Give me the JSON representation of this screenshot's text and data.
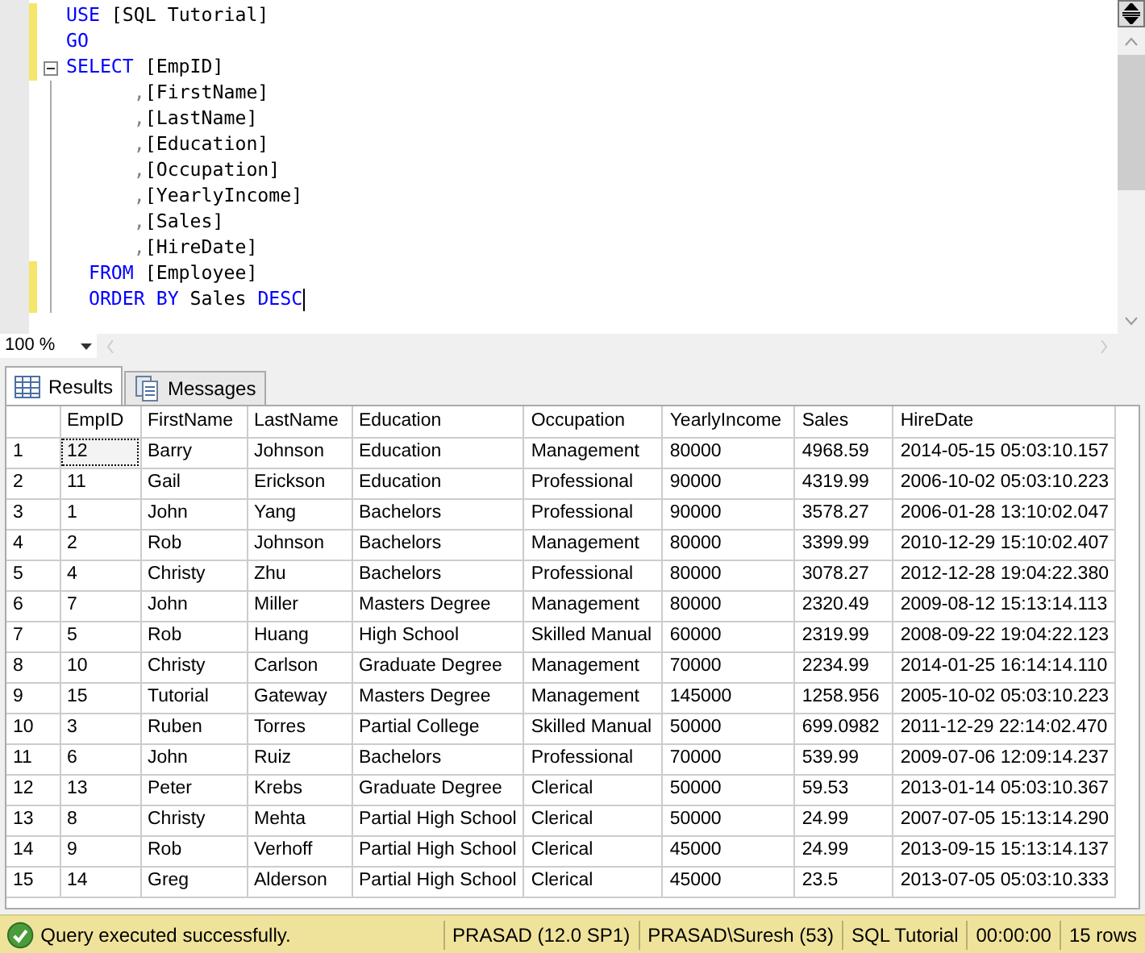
{
  "editor": {
    "lines": [
      {
        "changed": true,
        "tokens": [
          {
            "kind": "keyword",
            "text": "USE"
          },
          {
            "kind": "text",
            "text": " [SQL Tutorial]"
          }
        ]
      },
      {
        "changed": true,
        "tokens": [
          {
            "kind": "keyword",
            "text": "GO"
          }
        ]
      },
      {
        "changed": true,
        "fold": true,
        "tokens": [
          {
            "kind": "keyword",
            "text": "SELECT"
          },
          {
            "kind": "text",
            "text": " [EmpID]"
          }
        ]
      },
      {
        "changed": false,
        "tokens": [
          {
            "kind": "punct",
            "text": "      ,"
          },
          {
            "kind": "text",
            "text": "[FirstName]"
          }
        ]
      },
      {
        "changed": false,
        "tokens": [
          {
            "kind": "punct",
            "text": "      ,"
          },
          {
            "kind": "text",
            "text": "[LastName]"
          }
        ]
      },
      {
        "changed": false,
        "tokens": [
          {
            "kind": "punct",
            "text": "      ,"
          },
          {
            "kind": "text",
            "text": "[Education]"
          }
        ]
      },
      {
        "changed": false,
        "tokens": [
          {
            "kind": "punct",
            "text": "      ,"
          },
          {
            "kind": "text",
            "text": "[Occupation]"
          }
        ]
      },
      {
        "changed": false,
        "tokens": [
          {
            "kind": "punct",
            "text": "      ,"
          },
          {
            "kind": "text",
            "text": "[YearlyIncome]"
          }
        ]
      },
      {
        "changed": false,
        "tokens": [
          {
            "kind": "punct",
            "text": "      ,"
          },
          {
            "kind": "text",
            "text": "[Sales]"
          }
        ]
      },
      {
        "changed": false,
        "tokens": [
          {
            "kind": "punct",
            "text": "      ,"
          },
          {
            "kind": "text",
            "text": "[HireDate]"
          }
        ]
      },
      {
        "changed": true,
        "tokens": [
          {
            "kind": "keyword",
            "text": "  FROM"
          },
          {
            "kind": "text",
            "text": " [Employee]"
          }
        ]
      },
      {
        "changed": true,
        "tokens": [
          {
            "kind": "keyword",
            "text": "  ORDER BY"
          },
          {
            "kind": "text",
            "text": " Sales "
          },
          {
            "kind": "keyword",
            "text": "DESC"
          }
        ]
      }
    ]
  },
  "zoom": "100 %",
  "tabs": [
    {
      "label": "Results",
      "selected": true
    },
    {
      "label": "Messages",
      "selected": false
    }
  ],
  "table": {
    "columns": [
      "EmpID",
      "FirstName",
      "LastName",
      "Education",
      "Occupation",
      "YearlyIncome",
      "Sales",
      "HireDate"
    ],
    "rows": [
      {
        "n": "1",
        "selected": true,
        "cells": [
          "12",
          "Barry",
          "Johnson",
          "Education",
          "Management",
          "80000",
          "4968.59",
          "2014-05-15 05:03:10.157"
        ]
      },
      {
        "n": "2",
        "selected": false,
        "cells": [
          "11",
          "Gail",
          "Erickson",
          "Education",
          "Professional",
          "90000",
          "4319.99",
          "2006-10-02 05:03:10.223"
        ]
      },
      {
        "n": "3",
        "selected": false,
        "cells": [
          "1",
          "John",
          "Yang",
          "Bachelors",
          "Professional",
          "90000",
          "3578.27",
          "2006-01-28 13:10:02.047"
        ]
      },
      {
        "n": "4",
        "selected": false,
        "cells": [
          "2",
          "Rob",
          "Johnson",
          "Bachelors",
          "Management",
          "80000",
          "3399.99",
          "2010-12-29 15:10:02.407"
        ]
      },
      {
        "n": "5",
        "selected": false,
        "cells": [
          "4",
          "Christy",
          "Zhu",
          "Bachelors",
          "Professional",
          "80000",
          "3078.27",
          "2012-12-28 19:04:22.380"
        ]
      },
      {
        "n": "6",
        "selected": false,
        "cells": [
          "7",
          "John",
          "Miller",
          "Masters Degree",
          "Management",
          "80000",
          "2320.49",
          "2009-08-12 15:13:14.113"
        ]
      },
      {
        "n": "7",
        "selected": false,
        "cells": [
          "5",
          "Rob",
          "Huang",
          "High School",
          "Skilled Manual",
          "60000",
          "2319.99",
          "2008-09-22 19:04:22.123"
        ]
      },
      {
        "n": "8",
        "selected": false,
        "cells": [
          "10",
          "Christy",
          "Carlson",
          "Graduate Degree",
          "Management",
          "70000",
          "2234.99",
          "2014-01-25 16:14:14.110"
        ]
      },
      {
        "n": "9",
        "selected": false,
        "cells": [
          "15",
          "Tutorial",
          "Gateway",
          "Masters Degree",
          "Management",
          "145000",
          "1258.956",
          "2005-10-02 05:03:10.223"
        ]
      },
      {
        "n": "10",
        "selected": false,
        "cells": [
          "3",
          "Ruben",
          "Torres",
          "Partial College",
          "Skilled Manual",
          "50000",
          "699.0982",
          "2011-12-29 22:14:02.470"
        ]
      },
      {
        "n": "11",
        "selected": false,
        "cells": [
          "6",
          "John",
          "Ruiz",
          "Bachelors",
          "Professional",
          "70000",
          "539.99",
          "2009-07-06 12:09:14.237"
        ]
      },
      {
        "n": "12",
        "selected": false,
        "cells": [
          "13",
          "Peter",
          "Krebs",
          "Graduate Degree",
          "Clerical",
          "50000",
          "59.53",
          "2013-01-14 05:03:10.367"
        ]
      },
      {
        "n": "13",
        "selected": false,
        "cells": [
          "8",
          "Christy",
          "Mehta",
          "Partial High School",
          "Clerical",
          "50000",
          "24.99",
          "2007-07-05 15:13:14.290"
        ]
      },
      {
        "n": "14",
        "selected": false,
        "cells": [
          "9",
          "Rob",
          "Verhoff",
          "Partial High School",
          "Clerical",
          "45000",
          "24.99",
          "2013-09-15 15:13:14.137"
        ]
      },
      {
        "n": "15",
        "selected": false,
        "cells": [
          "14",
          "Greg",
          "Alderson",
          "Partial High School",
          "Clerical",
          "45000",
          "23.5",
          "2013-07-05 05:03:10.333"
        ]
      }
    ]
  },
  "status_bar": {
    "message": "Query executed successfully.",
    "segments": [
      "PRASAD (12.0 SP1)",
      "PRASAD\\Suresh (53)",
      "SQL Tutorial",
      "00:00:00",
      "15 rows"
    ]
  }
}
